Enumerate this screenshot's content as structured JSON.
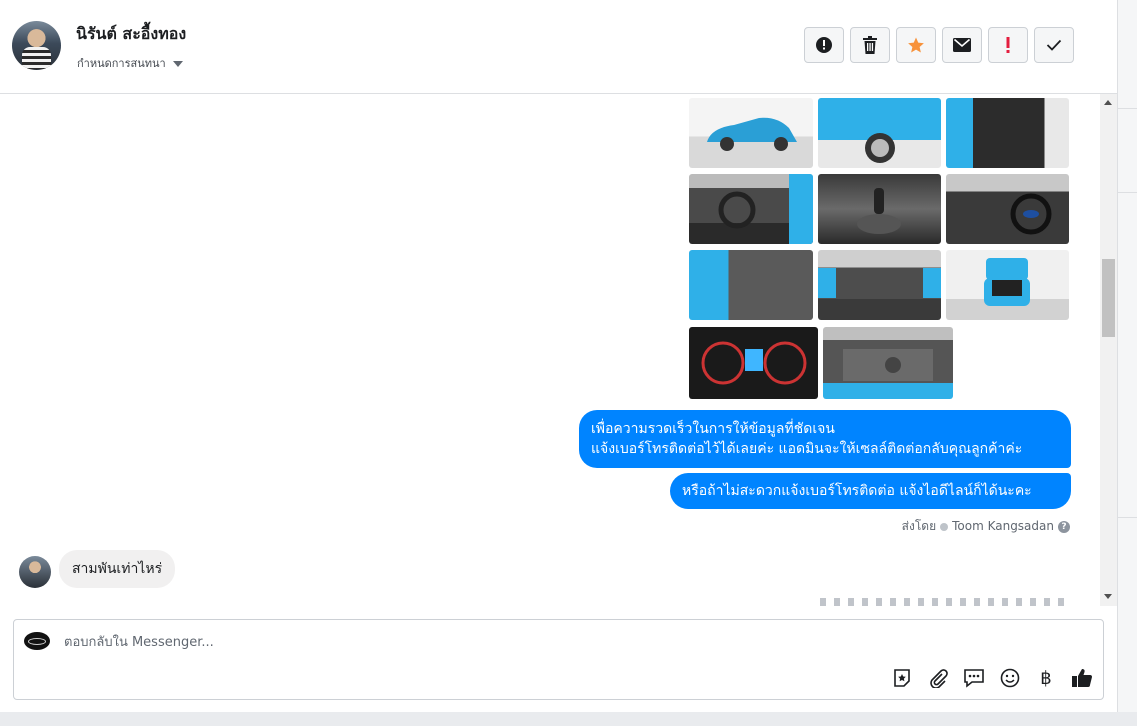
{
  "header": {
    "contact_name": "นิรันต์ สะอื้งทอง",
    "subtitle": "กำหนดการสนทนา",
    "tools": [
      {
        "name": "mark-spam",
        "icon": "alert-circle-icon"
      },
      {
        "name": "delete",
        "icon": "trash-icon"
      },
      {
        "name": "star",
        "icon": "star-icon"
      },
      {
        "name": "mark-unread",
        "icon": "envelope-icon"
      },
      {
        "name": "follow-up",
        "icon": "exclamation-icon"
      },
      {
        "name": "mark-done",
        "icon": "check-icon"
      }
    ]
  },
  "conversation": {
    "photos": [
      {
        "subject": "car-side-exterior"
      },
      {
        "subject": "car-front-wheel"
      },
      {
        "subject": "car-door-panel"
      },
      {
        "subject": "dashboard-steering"
      },
      {
        "subject": "gear-shift"
      },
      {
        "subject": "dashboard-driver-view"
      },
      {
        "subject": "rear-seat"
      },
      {
        "subject": "interior-center-console"
      },
      {
        "subject": "car-rear-open-trunk"
      },
      {
        "subject": "instrument-cluster"
      },
      {
        "subject": "engine-bay"
      }
    ],
    "outgoing": {
      "line1": "เพื่อความรวดเร็วในการให้ข้อมูลที่ชัดเจน",
      "line2": "แจ้งเบอร์โทรติดต่อไว้ได้เลยค่ะ แอดมินจะให้เซลล์ติดต่อกลับคุณลูกค้าค่ะ",
      "line3": "หรือถ้าไม่สะดวกแจ้งเบอร์โทรติดต่อ แจ้งไอดีไลน์ก็ได้นะคะ"
    },
    "sent_by_label": "ส่งโดย",
    "sent_by_name": "Toom Kangsadan",
    "incoming": {
      "text": "สามพันเท่าไหร่"
    }
  },
  "composer": {
    "placeholder": "ตอบกลับใน Messenger...",
    "icons": [
      "sticker-icon",
      "attachment-icon",
      "saved-replies-icon",
      "emoji-icon",
      "baht-icon",
      "thumbs-up-icon"
    ]
  },
  "colors": {
    "accent": "#0084ff",
    "star": "#f7923b",
    "follow_up": "#e41e3f"
  }
}
